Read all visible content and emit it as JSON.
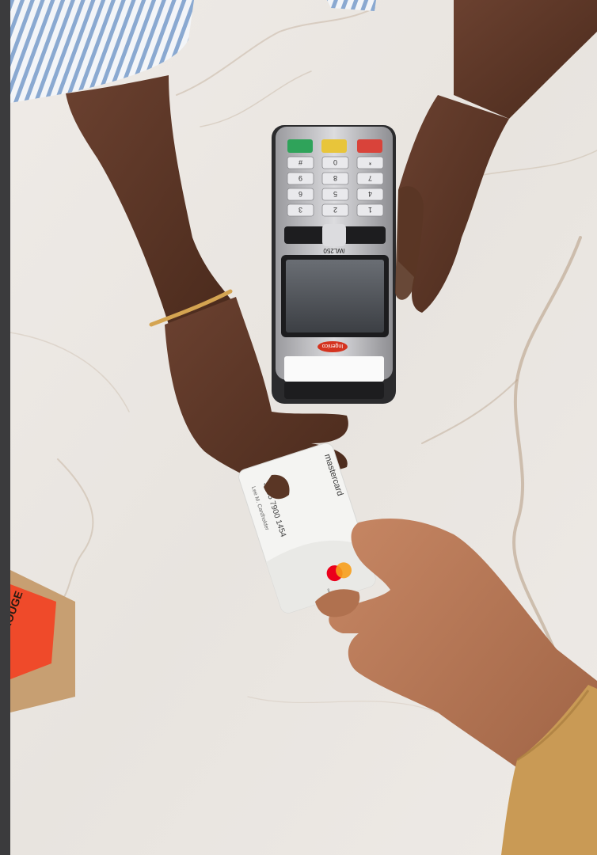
{
  "image": {
    "alt": "",
    "colors": {
      "marble": "#ece8e3",
      "vein": "#b49a82",
      "terminal_body": "#2b2b2d",
      "terminal_trim": "#c9c9cc",
      "key_green": "#2fa35a",
      "key_yellow": "#e8c53a",
      "key_red": "#d9433a",
      "screen": "#4a4d52",
      "brand_badge": "#d4331f",
      "card_body": "#f4f4f2",
      "mc_red": "#eb001b",
      "mc_yellow": "#f79e1b",
      "skin_dark": "#5a3625",
      "skin_light": "#b0714f",
      "sleeve_stripe": "#8aa9d1",
      "sleeve_mustard": "#c99a55",
      "box_kraft": "#c79f72",
      "box_red": "#ef4a2a",
      "bracelet": "#d4a451"
    }
  },
  "terminal": {
    "model": "iWL250",
    "brand": "Ingenico",
    "keys": [
      "1",
      "2",
      "3",
      "4",
      "5",
      "6",
      "7",
      "8",
      "9",
      "*",
      "0",
      "#"
    ]
  },
  "card": {
    "brand": "mastercard",
    "number": "5355 7900 1454",
    "holder": "Lee M. Cardholder",
    "mark_text": "mastercard"
  },
  "box": {
    "label": "ROUGE"
  }
}
